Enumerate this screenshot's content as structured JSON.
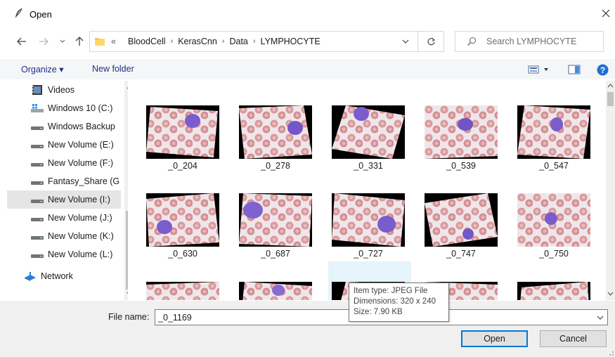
{
  "window": {
    "title": "Open"
  },
  "address": {
    "overflow": "«",
    "crumbs": [
      "BloodCell",
      "KerasCnn",
      "Data",
      "LYMPHOCYTE"
    ]
  },
  "search": {
    "placeholder": "Search LYMPHOCYTE"
  },
  "toolbar": {
    "organize_label": "Organize ▾",
    "new_folder_label": "New folder"
  },
  "sidebar": {
    "items": [
      {
        "label": "Videos",
        "icon": "videos-icon"
      },
      {
        "label": "Windows 10 (C:)",
        "icon": "windows-drive-icon"
      },
      {
        "label": "Windows Backup",
        "icon": "drive-icon"
      },
      {
        "label": "New Volume (E:)",
        "icon": "drive-icon"
      },
      {
        "label": "New Volume (F:)",
        "icon": "drive-icon"
      },
      {
        "label": "Fantasy_Share (G",
        "icon": "drive-icon"
      },
      {
        "label": "New Volume (I:)",
        "icon": "drive-icon",
        "selected": true
      },
      {
        "label": "New Volume (J:)",
        "icon": "drive-icon"
      },
      {
        "label": "New Volume (K:)",
        "icon": "drive-icon"
      },
      {
        "label": "New Volume (L:)",
        "icon": "drive-icon"
      },
      {
        "label": "Network",
        "icon": "network-icon"
      }
    ]
  },
  "files": {
    "row1": [
      "_0_204",
      "_0_278",
      "_0_331",
      "_0_539",
      "_0_547"
    ],
    "row2": [
      "_0_630",
      "_0_687",
      "_0_727",
      "_0_747",
      "_0_750"
    ]
  },
  "tooltip": {
    "type": "Item type: JPEG File",
    "dimensions": "Dimensions: 320 x 240",
    "size": "Size: 7.90 KB"
  },
  "footer": {
    "file_name_label": "File name:",
    "file_name_value": "_0_1169",
    "open_label": "Open",
    "cancel_label": "Cancel"
  },
  "colors": {
    "accent": "#0078d7",
    "link": "#1e3287",
    "selection": "#e5e5e5",
    "hover": "#e5f3fb",
    "cell": "#7a5ccc",
    "rbc": "#d9999a"
  }
}
